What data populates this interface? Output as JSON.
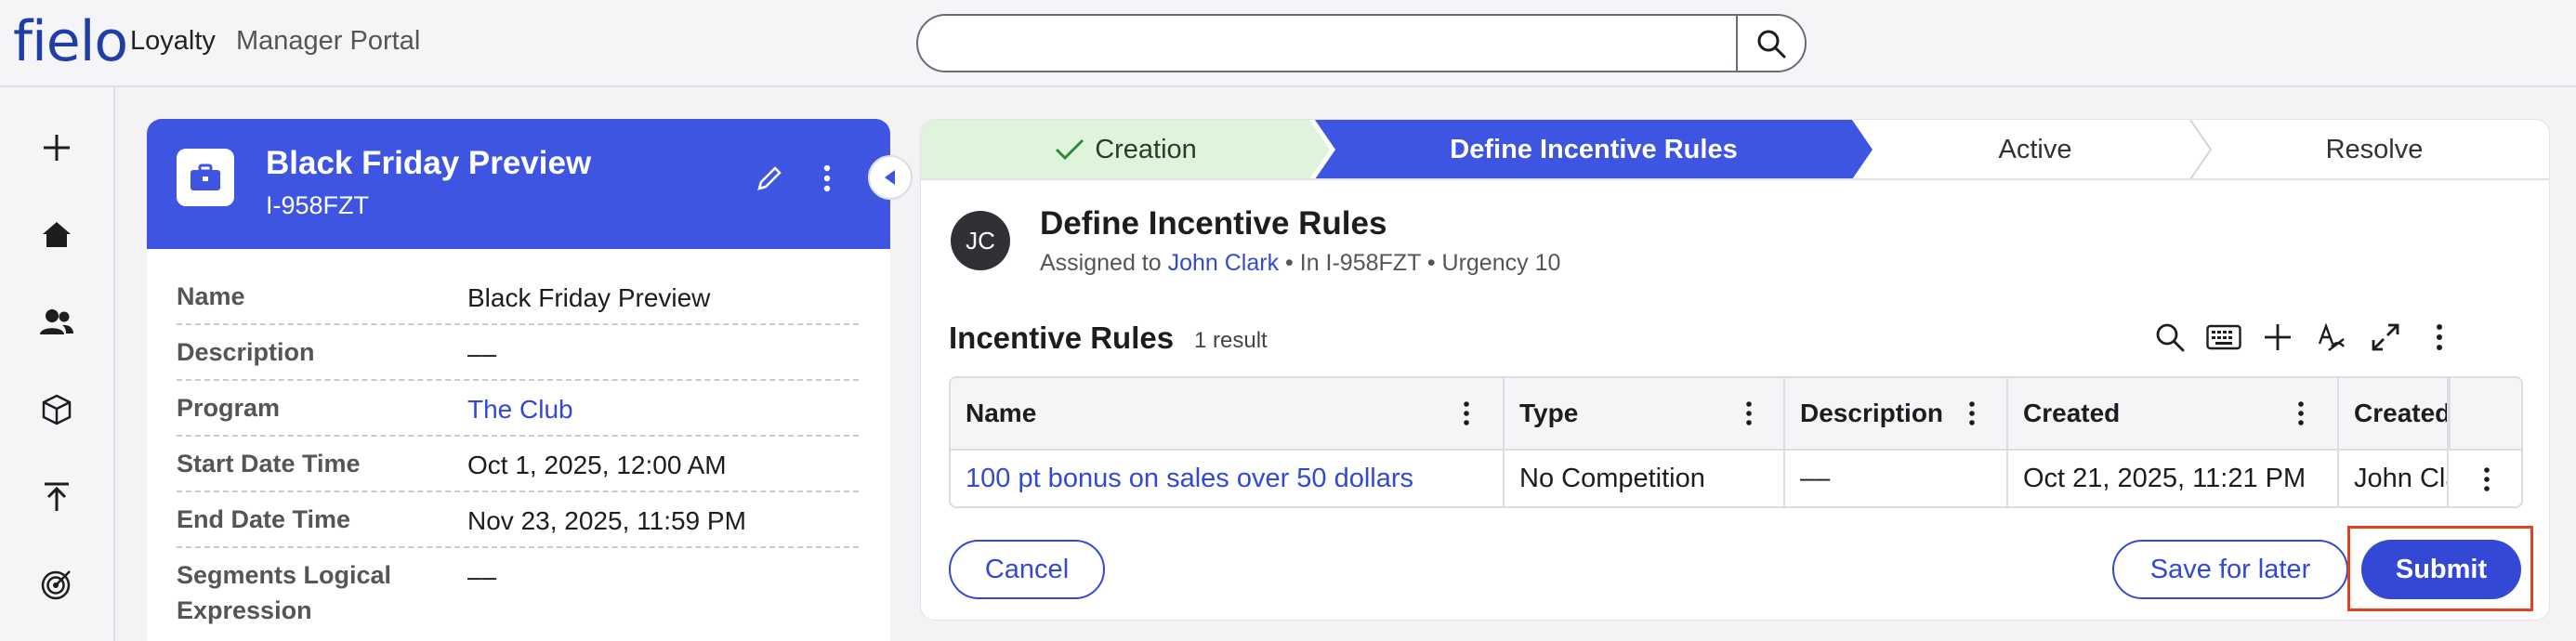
{
  "header": {
    "logo": "fielo",
    "app_name": "Loyalty",
    "app_subtitle": "Manager Portal",
    "search": {
      "value": "",
      "placeholder": ""
    }
  },
  "rail": {
    "items": [
      "plus-icon",
      "home-icon",
      "users-icon",
      "cube-icon",
      "upload-icon",
      "target-icon"
    ]
  },
  "record": {
    "title": "Black Friday Preview",
    "id": "I-958FZT",
    "fields": [
      {
        "label": "Name",
        "value": "Black Friday Preview"
      },
      {
        "label": "Description",
        "value": "––"
      },
      {
        "label": "Program",
        "value": "The Club"
      },
      {
        "label": "Start Date Time",
        "value": "Oct 1, 2025, 12:00 AM"
      },
      {
        "label": "End Date Time",
        "value": "Nov 23, 2025, 11:59 PM"
      },
      {
        "label": "Segments Logical Expression",
        "value": "––"
      }
    ]
  },
  "stepper": {
    "steps": [
      {
        "label": "Creation",
        "state": "done"
      },
      {
        "label": "Define Incentive Rules",
        "state": "current"
      },
      {
        "label": "Active",
        "state": "pending"
      },
      {
        "label": "Resolve",
        "state": "pending"
      }
    ]
  },
  "task": {
    "avatar_initials": "JC",
    "title": "Define Incentive Rules",
    "assigned_prefix": "Assigned to",
    "assignee": "John Clark",
    "meta": "• In I-958FZT • Urgency 10"
  },
  "rules": {
    "title": "Incentive Rules",
    "count": "1 result",
    "columns": [
      "Name",
      "Type",
      "Description",
      "Created",
      "Created By"
    ],
    "rows": [
      {
        "name": "100 pt bonus on sales over 50 dollars",
        "type": "No Competition",
        "description": "––",
        "created": "Oct 21, 2025, 11:21 PM",
        "created_by": "John Clark"
      }
    ]
  },
  "actions": {
    "cancel": "Cancel",
    "save_for_later": "Save for later",
    "submit": "Submit"
  },
  "colors": {
    "brand": "#3d55e0",
    "link": "#3448d6",
    "done_step": "#dff5db",
    "highlight": "#e0411f"
  }
}
